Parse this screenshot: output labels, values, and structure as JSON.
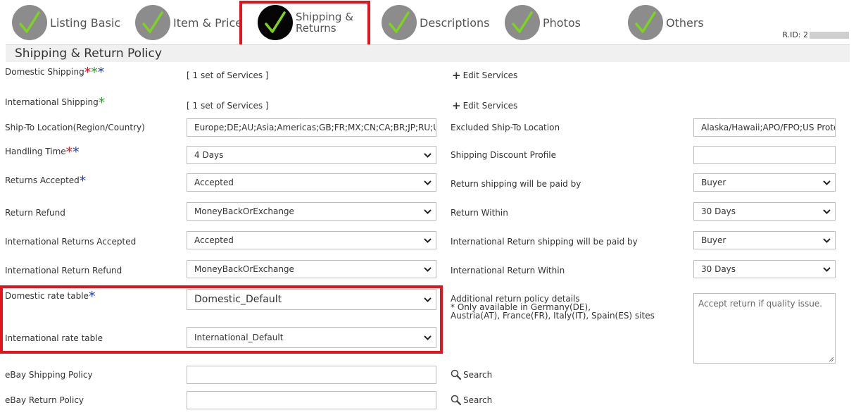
{
  "steps": [
    {
      "label": "Listing Basic",
      "line2": ""
    },
    {
      "label": "Item & Price",
      "line2": ""
    },
    {
      "label": "Shipping &",
      "line2": "Returns"
    },
    {
      "label": "Descriptions",
      "line2": ""
    },
    {
      "label": "Photos",
      "line2": ""
    },
    {
      "label": "Others",
      "line2": ""
    }
  ],
  "rid_label": "R.ID: 2",
  "section_title": "Shipping & Return Policy",
  "domestic_shipping": {
    "label": "Domestic Shipping",
    "services": "[ 1 set of Services ]",
    "edit": "Edit Services"
  },
  "international_shipping": {
    "label": "International Shipping",
    "services": "[ 1 set of Services ]",
    "edit": "Edit Services"
  },
  "ship_to": {
    "label": "Ship-To Location(Region/Country)",
    "value": "Europe;DE;AU;Asia;Americas;GB;FR;MX;CN;CA;BR;JP;RU;US"
  },
  "excluded": {
    "label": "Excluded Ship-To Location",
    "value": "Alaska/Hawaii;APO/FPO;US Protectorates"
  },
  "handling_time": {
    "label": "Handling Time",
    "value": "4 Days"
  },
  "shipping_discount": {
    "label": "Shipping Discount Profile",
    "value": ""
  },
  "returns_accepted": {
    "label": "Returns Accepted",
    "value": "Accepted"
  },
  "return_paid_by": {
    "label": "Return shipping will be paid by",
    "value": "Buyer"
  },
  "return_refund": {
    "label": "Return Refund",
    "value": "MoneyBackOrExchange"
  },
  "return_within": {
    "label": "Return Within",
    "value": "30 Days"
  },
  "intl_returns_accepted": {
    "label": "International Returns Accepted",
    "value": "Accepted"
  },
  "intl_return_paid_by": {
    "label": "International Return shipping will be paid by",
    "value": "Buyer"
  },
  "intl_return_refund": {
    "label": "International Return Refund",
    "value": "MoneyBackOrExchange"
  },
  "intl_return_within": {
    "label": "International Return Within",
    "value": "30 Days"
  },
  "domestic_rate": {
    "label": "Domestic rate table",
    "value": "Domestic_Default"
  },
  "intl_rate": {
    "label": "International rate table",
    "value": "International_Default"
  },
  "additional_policy": {
    "line1": "Additional return policy details",
    "line2": "* Only available in Germany(DE),",
    "line3": "Austria(AT), France(FR), Italy(IT), Spain(ES) sites",
    "value": "Accept return if quality issue."
  },
  "ebay_shipping_policy": {
    "label": "eBay Shipping Policy",
    "value": "",
    "search": "Search"
  },
  "ebay_return_policy": {
    "label": "eBay Return Policy",
    "value": "",
    "search": "Search"
  },
  "colors": {
    "required_red": "#e3141b",
    "required_green": "#2f9a2f",
    "required_blue": "#1a3ec2",
    "check": "#7ed321",
    "highlight": "#e3141b"
  }
}
